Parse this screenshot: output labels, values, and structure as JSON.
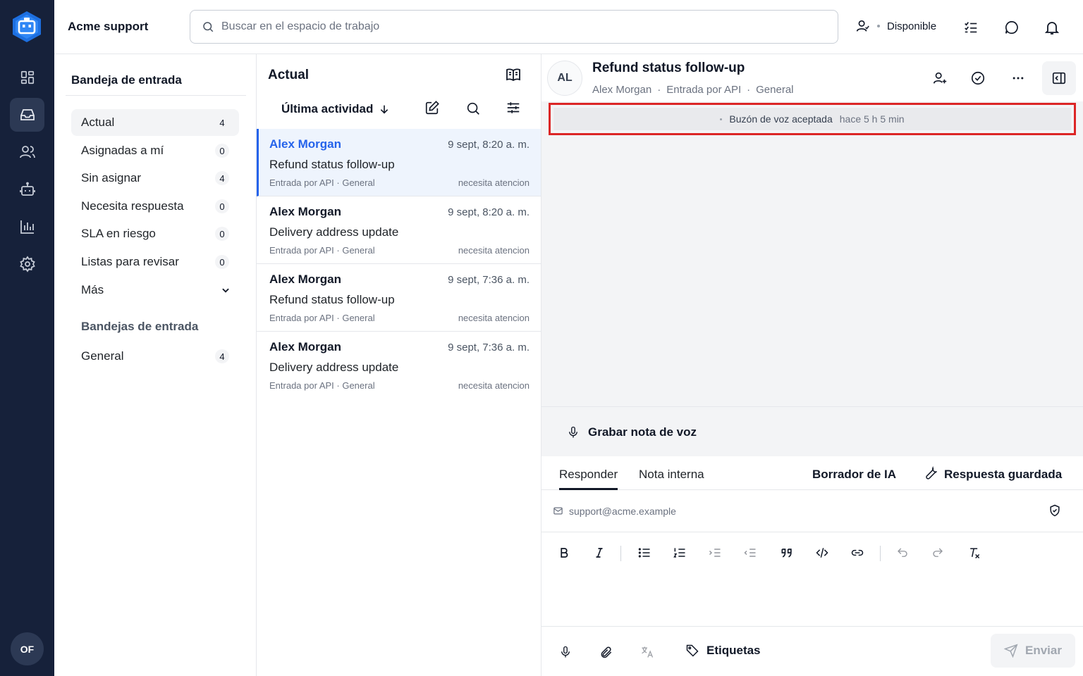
{
  "rail": {
    "avatar_initials": "OF"
  },
  "topbar": {
    "workspace_name": "Acme support",
    "search_placeholder": "Buscar en el espacio de trabajo",
    "availability": "Disponible"
  },
  "inbox": {
    "title": "Bandeja de entrada",
    "items": [
      {
        "label": "Actual",
        "count": "4"
      },
      {
        "label": "Asignadas a mí",
        "count": "0"
      },
      {
        "label": "Sin asignar",
        "count": "4"
      },
      {
        "label": "Necesita respuesta",
        "count": "0"
      },
      {
        "label": "SLA en riesgo",
        "count": "0"
      },
      {
        "label": "Listas para revisar",
        "count": "0"
      },
      {
        "label": "Más"
      }
    ],
    "section_title": "Bandejas de entrada",
    "channels": [
      {
        "label": "General",
        "count": "4"
      }
    ]
  },
  "list": {
    "title": "Actual",
    "sort_label": "Última actividad",
    "conversations": [
      {
        "name": "Alex Morgan",
        "time": "9 sept, 8:20 a. m.",
        "subject": "Refund status follow-up",
        "meta": "Entrada por API · General",
        "tag": "necesita atencion"
      },
      {
        "name": "Alex Morgan",
        "time": "9 sept, 8:20 a. m.",
        "subject": "Delivery address update",
        "meta": "Entrada por API · General",
        "tag": "necesita atencion"
      },
      {
        "name": "Alex Morgan",
        "time": "9 sept, 7:36 a. m.",
        "subject": "Refund status follow-up",
        "meta": "Entrada por API · General",
        "tag": "necesita atencion"
      },
      {
        "name": "Alex Morgan",
        "time": "9 sept, 7:36 a. m.",
        "subject": "Delivery address update",
        "meta": "Entrada por API · General",
        "tag": "necesita atencion"
      }
    ]
  },
  "detail": {
    "avatar": "AL",
    "title": "Refund status follow-up",
    "contact": "Alex Morgan",
    "source": "Entrada por API",
    "inbox": "General",
    "activity_message": "Buzón de voz aceptada",
    "activity_time": "hace 5 h 5 min",
    "voice_note_label": "Grabar nota de voz"
  },
  "composer": {
    "tab_reply": "Responder",
    "tab_note": "Nota interna",
    "ai_draft": "Borrador de IA",
    "saved_reply": "Respuesta guardada",
    "from_email": "support@acme.example",
    "labels_btn": "Etiquetas",
    "send_btn": "Enviar"
  }
}
